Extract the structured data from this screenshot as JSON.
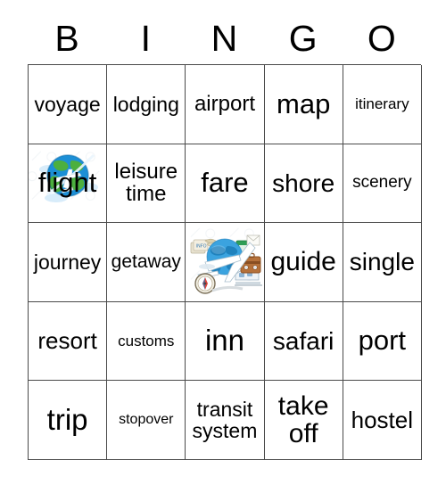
{
  "card": {
    "title": "BINGO",
    "header_letters": [
      "B",
      "I",
      "N",
      "G",
      "O"
    ],
    "rows": [
      [
        {
          "text": "voyage",
          "size": "fs-23",
          "art": "none"
        },
        {
          "text": "lodging",
          "size": "fs-23",
          "art": "none"
        },
        {
          "text": "airport",
          "size": "fs-24",
          "art": "none"
        },
        {
          "text": "map",
          "size": "fs-31",
          "art": "none"
        },
        {
          "text": "itinerary",
          "size": "fs-17",
          "art": "none"
        }
      ],
      [
        {
          "text": "flight",
          "size": "fs-31",
          "art": "globe-airplane-image"
        },
        {
          "text": "leisure\ntime",
          "size": "fs-24",
          "art": "none"
        },
        {
          "text": "fare",
          "size": "fs-31",
          "art": "none"
        },
        {
          "text": "shore",
          "size": "fs-28",
          "art": "none"
        },
        {
          "text": "scenery",
          "size": "fs-19",
          "art": "none"
        }
      ],
      [
        {
          "text": "journey",
          "size": "fs-23",
          "art": "none"
        },
        {
          "text": "getaway",
          "size": "fs-21",
          "art": "none"
        },
        {
          "text": "",
          "size": "fs-17",
          "art": "travel-collage-image"
        },
        {
          "text": "guide",
          "size": "fs-30",
          "art": "none"
        },
        {
          "text": "single",
          "size": "fs-28",
          "art": "none"
        }
      ],
      [
        {
          "text": "resort",
          "size": "fs-26",
          "art": "none"
        },
        {
          "text": "customs",
          "size": "fs-17",
          "art": "none"
        },
        {
          "text": "inn",
          "size": "fs-33",
          "art": "none"
        },
        {
          "text": "safari",
          "size": "fs-28",
          "art": "none"
        },
        {
          "text": "port",
          "size": "fs-31",
          "art": "none"
        }
      ],
      [
        {
          "text": "trip",
          "size": "fs-33",
          "art": "none"
        },
        {
          "text": "stopover",
          "size": "fs-16",
          "art": "none"
        },
        {
          "text": "transit\nsystem",
          "size": "fs-23",
          "art": "none"
        },
        {
          "text": "take\noff",
          "size": "fs-30",
          "art": "none"
        },
        {
          "text": "hostel",
          "size": "fs-26",
          "art": "none"
        }
      ]
    ],
    "colors": {
      "background": "#ffffff",
      "text": "#000000",
      "grid_line": "#4a4a4a",
      "globe_ocean": "#1c8fd6",
      "globe_land": "#4caf3f",
      "airplane": "#ffffff",
      "suitcase": "#b06a30",
      "cloud": "#cfe8f7"
    }
  }
}
